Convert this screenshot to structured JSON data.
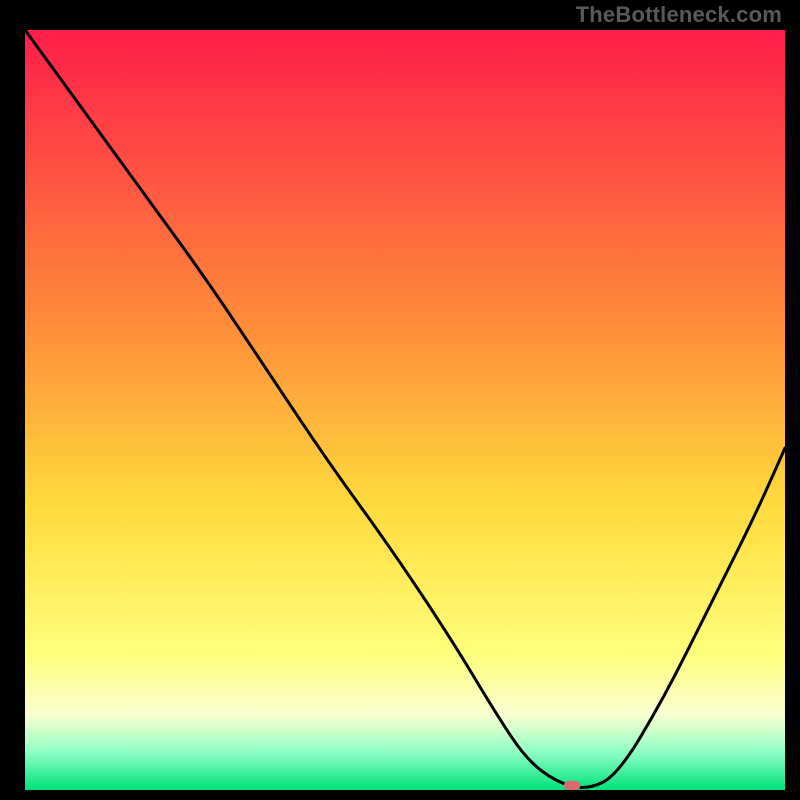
{
  "attribution": "TheBottleneck.com",
  "chart_data": {
    "type": "line",
    "title": "",
    "xlabel": "",
    "ylabel": "",
    "xlim": [
      0,
      100
    ],
    "ylim": [
      0,
      100
    ],
    "gradient_stops": [
      {
        "offset": 0.0,
        "color": "#ff1d4a"
      },
      {
        "offset": 0.38,
        "color": "#ff8a3a"
      },
      {
        "offset": 0.62,
        "color": "#ffd93c"
      },
      {
        "offset": 0.82,
        "color": "#ffff7a"
      },
      {
        "offset": 0.9,
        "color": "#fbffd0"
      },
      {
        "offset": 0.95,
        "color": "#8fffc4"
      },
      {
        "offset": 1.0,
        "color": "#00e27a"
      }
    ],
    "series": [
      {
        "name": "bottleneck-curve",
        "x": [
          0,
          8,
          16,
          24,
          32,
          40,
          48,
          56,
          62,
          66,
          70,
          74,
          78,
          84,
          90,
          96,
          100
        ],
        "y": [
          100,
          89,
          78,
          67,
          55,
          43,
          32,
          20,
          10,
          4,
          1,
          0,
          2,
          12,
          24,
          36,
          45
        ]
      }
    ],
    "marker": {
      "x": 72,
      "y": 0.6,
      "w": 2.2,
      "h": 1.2,
      "color": "#d96b6f",
      "name": "optimal-point"
    }
  }
}
